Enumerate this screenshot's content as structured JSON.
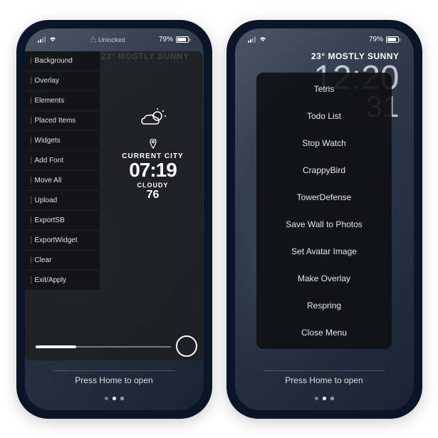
{
  "status": {
    "locked_label": "Unlocked",
    "battery_pct": "79%"
  },
  "left": {
    "weather_strip": "23° MOSTLY SUNNY",
    "side_menu": [
      "Background",
      "Overlay",
      "Elements",
      "Placed Items",
      "Widgets",
      "Add Font",
      "Move All",
      "Upload",
      "ExportSB",
      "ExportWidget",
      "Clear",
      "Exit/Apply"
    ],
    "widget": {
      "city": "CURRENT CITY",
      "time": "07:19",
      "condition": "CLOUDY",
      "temp": "76"
    }
  },
  "right": {
    "weather_strip": "23° MOSTLY SUNNY",
    "big_time_top": "12:20",
    "big_time_bottom": "31",
    "action_menu": [
      "Tetris",
      "Todo List",
      "Stop Watch",
      "CrappyBird",
      "TowerDefense",
      "Save Wall to Photos",
      "Set Avatar Image",
      "Make Overlay",
      "Respring",
      "Close Menu"
    ]
  },
  "bottom_hint": "Press Home to open"
}
